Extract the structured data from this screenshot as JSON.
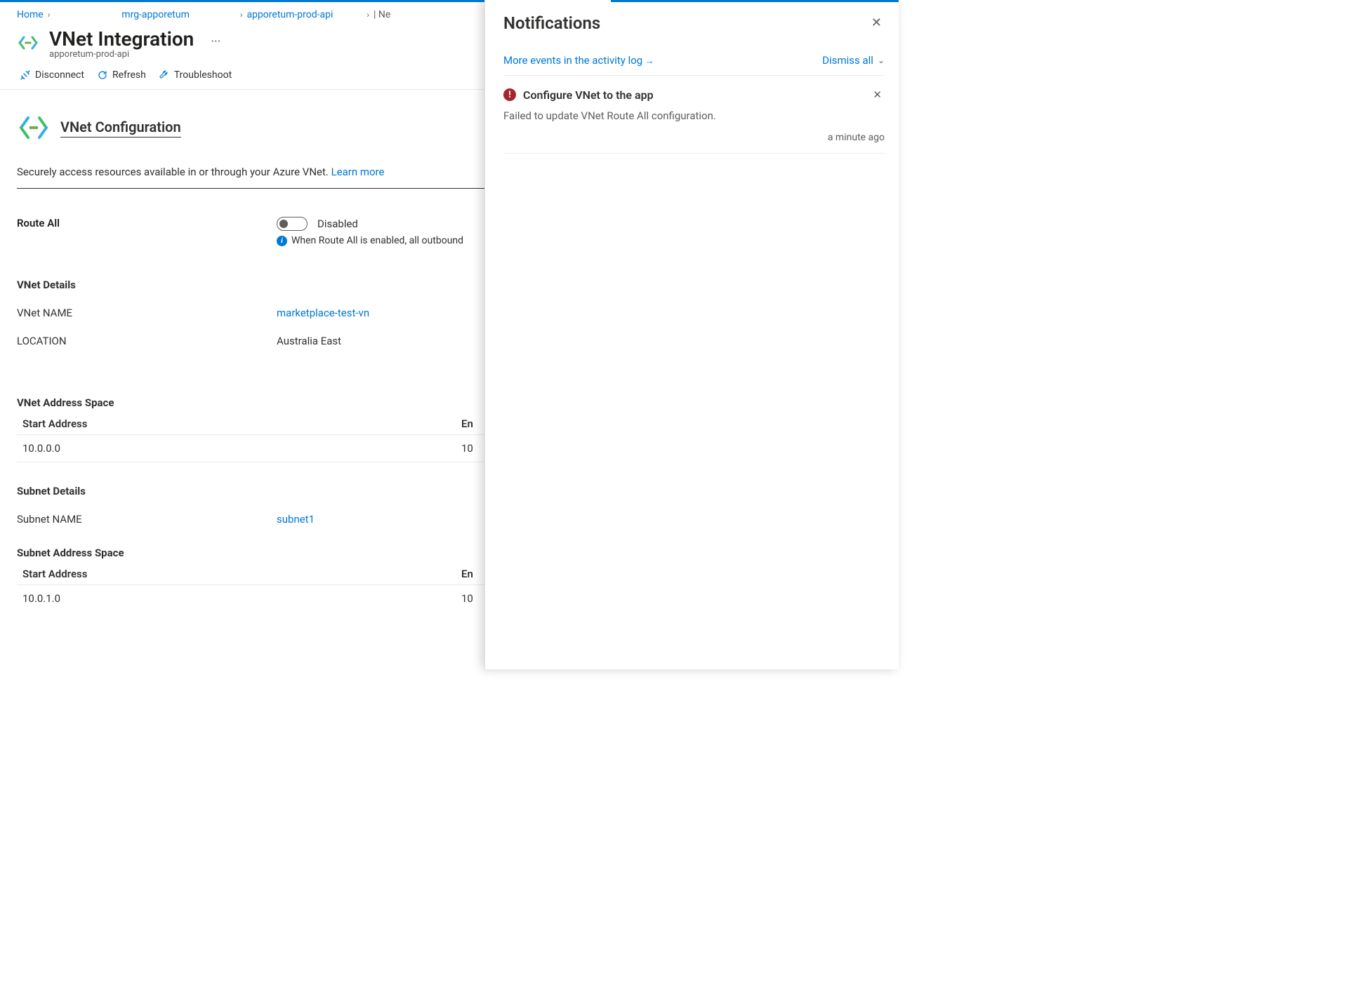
{
  "breadcrumb": {
    "home": "Home",
    "rg": "mrg-apporetum",
    "app": "apporetum-prod-api",
    "tail": "| Ne"
  },
  "header": {
    "title": "VNet Integration",
    "subtitle": "apporetum-prod-api",
    "more": "···"
  },
  "commands": {
    "disconnect": "Disconnect",
    "refresh": "Refresh",
    "troubleshoot": "Troubleshoot"
  },
  "config": {
    "section_title": "VNet Configuration",
    "desc_prefix": "Securely access resources available in or through your Azure VNet. ",
    "learn_more": "Learn more",
    "route_all_label": "Route All",
    "route_all_state": "Disabled",
    "route_all_info": "When Route All is enabled, all outbound"
  },
  "vnet_details": {
    "heading": "VNet Details",
    "name_label": "VNet NAME",
    "name_value": "marketplace-test-vn",
    "location_label": "LOCATION",
    "location_value": "Australia East"
  },
  "vnet_addr": {
    "heading": "VNet Address Space",
    "col_start": "Start Address",
    "col_end": "En",
    "row_start": "10.0.0.0",
    "row_end": "10"
  },
  "subnet_details": {
    "heading": "Subnet Details",
    "name_label": "Subnet NAME",
    "name_value": "subnet1"
  },
  "subnet_addr": {
    "heading": "Subnet Address Space",
    "col_start": "Start Address",
    "col_end": "En",
    "row_start": "10.0.1.0",
    "row_end": "10"
  },
  "notifications": {
    "title": "Notifications",
    "more_events": "More events in the activity log",
    "dismiss_all": "Dismiss all",
    "item": {
      "title": "Configure VNet to the app",
      "message": "Failed to update VNet Route All configuration.",
      "time": "a minute ago"
    }
  }
}
